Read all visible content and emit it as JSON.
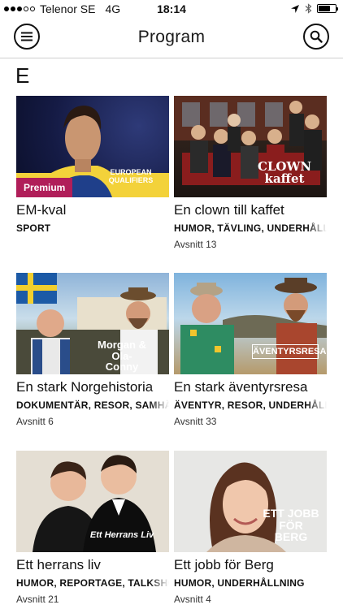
{
  "status_bar": {
    "carrier": "Telenor SE",
    "network": "4G",
    "time": "18:14",
    "signal_bars_filled": 3,
    "signal_bars_total": 5,
    "battery_level": 0.7
  },
  "header": {
    "title": "Program"
  },
  "section": {
    "letter": "E"
  },
  "programs": [
    {
      "title": "EM-kval",
      "genres": "SPORT",
      "episodes": "",
      "badge": "Premium",
      "overlay": "EUROPEAN QUALIFIERS"
    },
    {
      "title": "En clown till kaffet",
      "genres": "HUMOR, TÄVLING, UNDERHÅLLNING",
      "episodes": "Avsnitt 13",
      "badge": "",
      "overlay": "CLOWN kaffet"
    },
    {
      "title": "En stark Norgehistoria",
      "genres": "DOKUMENTÄR, RESOR, SAMHÄLLE",
      "episodes": "Avsnitt 6",
      "badge": "",
      "overlay": "Morgan & Ola-Conny"
    },
    {
      "title": "En stark äventyrsresa",
      "genres": "ÄVENTYR, RESOR, UNDERHÅLLNING",
      "episodes": "Avsnitt 33",
      "badge": "",
      "overlay": "ÄVENTYRSRESA"
    },
    {
      "title": "Ett herrans liv",
      "genres": "HUMOR, REPORTAGE, TALKSHOW",
      "episodes": "Avsnitt 21",
      "badge": "",
      "overlay": "Ett Herrans Liv"
    },
    {
      "title": "Ett jobb för Berg",
      "genres": "HUMOR, UNDERHÅLLNING",
      "episodes": "Avsnitt 4",
      "badge": "",
      "overlay": "ETT JOBB FÖR BERG"
    }
  ],
  "icons": {
    "menu": "hamburger-menu-icon",
    "search": "search-icon",
    "location": "location-arrow-icon",
    "bluetooth": "bluetooth-icon",
    "battery": "battery-icon"
  }
}
